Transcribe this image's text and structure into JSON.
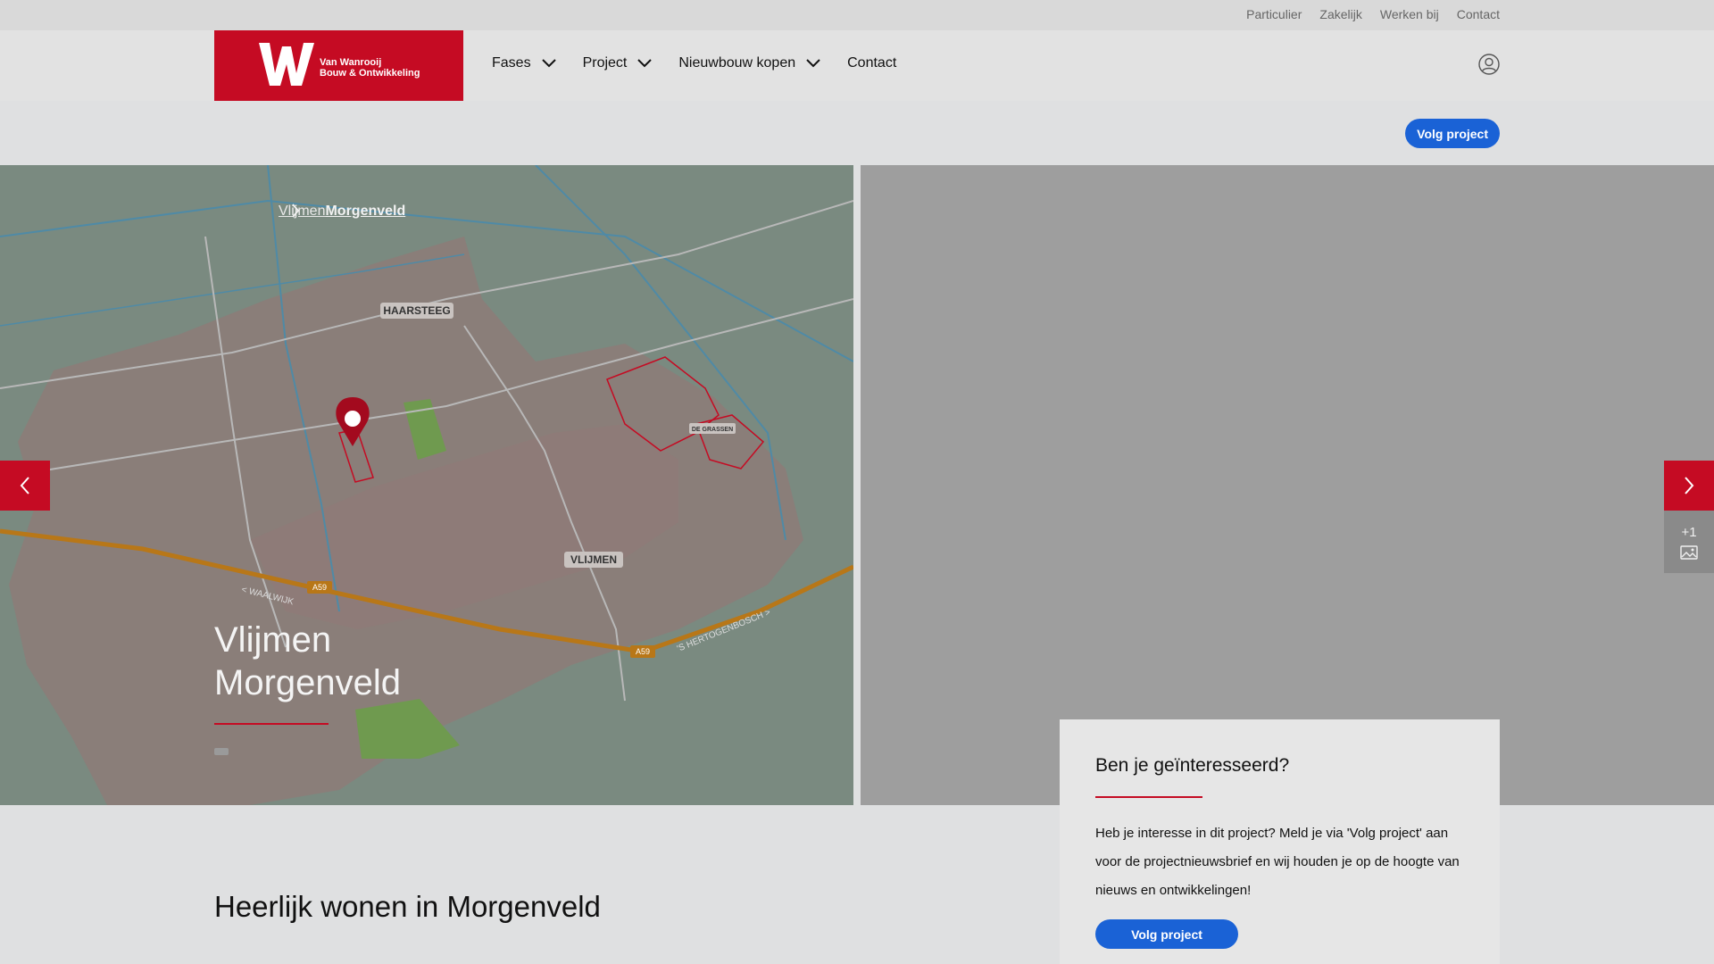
{
  "utility": {
    "links": [
      "Particulier",
      "Zakelijk",
      "Werken bij",
      "Contact"
    ]
  },
  "brand": {
    "name_line1": "Van Wanrooij",
    "name_line2": "Bouw & Ontwikkeling",
    "color": "#c50b23"
  },
  "nav": {
    "items": [
      {
        "label": "Fases",
        "dropdown": true
      },
      {
        "label": "Project",
        "dropdown": true
      },
      {
        "label": "Nieuwbouw kopen",
        "dropdown": true
      },
      {
        "label": "Contact",
        "dropdown": false
      }
    ],
    "account_icon": "user-icon"
  },
  "subbar": {
    "follow_label": "Volg project"
  },
  "hero": {
    "breadcrumb": {
      "parent": "Vlijmen",
      "current": "Morgenveld"
    },
    "title_line1": "Vlijmen",
    "title_line2": "Morgenveld",
    "photo_count": "+1",
    "map_labels": {
      "haarsteeg": "HAARSTEEG",
      "vlijmen": "VLIJMEN",
      "de_grassen": "DE GRASSEN",
      "waalwijk": "< WAALWIJK",
      "hertogenbosch": "'S HERTOGENBOSCH >",
      "road": "A59"
    }
  },
  "interest": {
    "title": "Ben je geïnteresseerd?",
    "text": "Heb je interesse in dit project? Meld je via 'Volg project' aan voor de projectnieuwsbrief en wij houden je op de hoogte van nieuws en ontwikkelingen!",
    "button": "Volg project"
  },
  "section": {
    "title": "Heerlijk wonen in Morgenveld"
  },
  "colors": {
    "accent_red": "#c50b23",
    "button_blue": "#1a62d6",
    "map_bg": "#7a8a80"
  }
}
